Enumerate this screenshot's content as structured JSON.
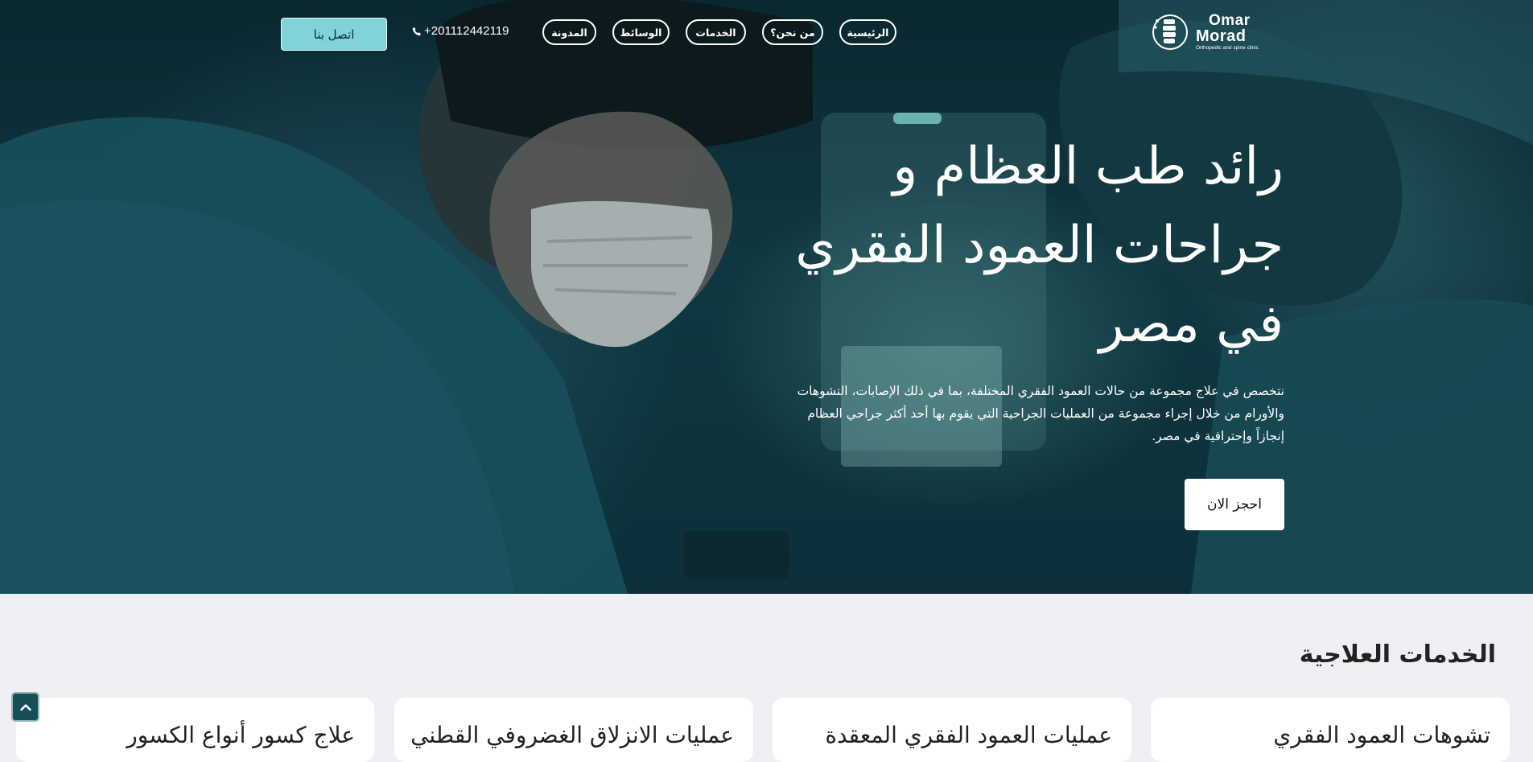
{
  "nav": {
    "logo": {
      "line1": "Omar",
      "line2": "Morad",
      "tagline": "Orthopedic and spine clinic"
    },
    "items": [
      {
        "label": "الرئيسية"
      },
      {
        "label": "من نحن؟"
      },
      {
        "label": "الخدمات"
      },
      {
        "label": "الوسائط"
      },
      {
        "label": "المدونة"
      }
    ],
    "phone": "+201112442119",
    "phone_icon": "phone-icon",
    "contact_label": "اتصل بنا"
  },
  "hero": {
    "title_lines": [
      "رائد طب العظام و",
      "جراحات العمود الفقري",
      "في مصر"
    ],
    "description_lines": [
      "نتخصص في علاج مجموعة من حالات العمود الفقري المختلفة، بما في ذلك الإصابات، التشوهات",
      "والأورام من خلال إجراء مجموعة من العمليات الجراحية التي يقوم بها أحد أكثر جراحي العظام",
      "إنجازاً وإحترافية في مصر."
    ],
    "book_label": "احجز الان"
  },
  "services": {
    "title": "الخدمات العلاجية",
    "cards": [
      {
        "title": "تشوهات العمود الفقري"
      },
      {
        "title": "عمليات العمود الفقري المعقدة"
      },
      {
        "title": "عمليات الانزلاق الغضروفي القطني"
      },
      {
        "title": "علاج كسور أنواع الكسور"
      }
    ]
  },
  "scroll_top_icon": "chevron-up-icon",
  "colors": {
    "accent": "#7fd3d9",
    "hero_bg": "#123e48",
    "page_bg": "#eef0f4",
    "scroll_btn": "#184e55"
  }
}
